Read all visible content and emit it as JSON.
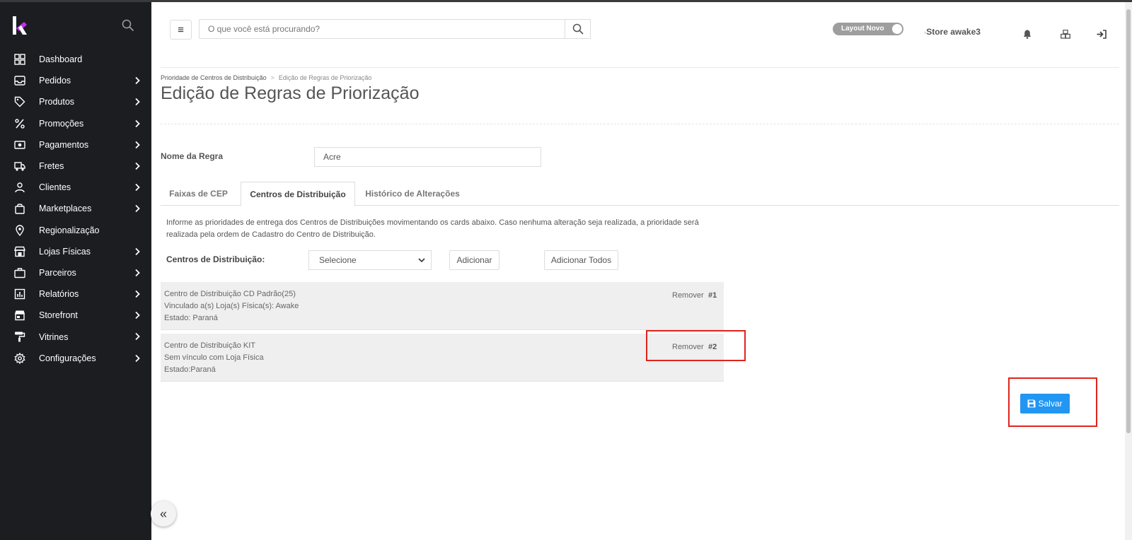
{
  "sidebar": {
    "items": [
      {
        "label": "Dashboard",
        "icon": "dashboard-icon",
        "chevron": false
      },
      {
        "label": "Pedidos",
        "icon": "inbox-icon",
        "chevron": true
      },
      {
        "label": "Produtos",
        "icon": "tag-icon",
        "chevron": true
      },
      {
        "label": "Promoções",
        "icon": "percent-icon",
        "chevron": true
      },
      {
        "label": "Pagamentos",
        "icon": "money-icon",
        "chevron": true
      },
      {
        "label": "Fretes",
        "icon": "truck-icon",
        "chevron": true
      },
      {
        "label": "Clientes",
        "icon": "user-icon",
        "chevron": true
      },
      {
        "label": "Marketplaces",
        "icon": "shopping-bag-icon",
        "chevron": true
      },
      {
        "label": "Regionalização",
        "icon": "location-pin-icon",
        "chevron": false
      },
      {
        "label": "Lojas Físicas",
        "icon": "store-icon",
        "chevron": true
      },
      {
        "label": "Parceiros",
        "icon": "briefcase-icon",
        "chevron": true
      },
      {
        "label": "Relatórios",
        "icon": "report-icon",
        "chevron": true
      },
      {
        "label": "Storefront",
        "icon": "storefront-icon",
        "chevron": true
      },
      {
        "label": "Vitrines",
        "icon": "paint-roller-icon",
        "chevron": true
      },
      {
        "label": "Configurações",
        "icon": "gear-icon",
        "chevron": true
      }
    ]
  },
  "header": {
    "search_placeholder": "O que você está procurando?",
    "toggle_label": "Layout Novo",
    "store_alt": "Store awake3"
  },
  "breadcrumb": {
    "parent": "Prioridade de Centros de Distribuição",
    "separator": ">",
    "current": "Edição de Regras de Priorização"
  },
  "page_title": "Edição de Regras de Priorização",
  "form": {
    "name_label": "Nome da Regra",
    "name_value": "Acre"
  },
  "tabs": [
    {
      "label": "Faixas de CEP",
      "active": false
    },
    {
      "label": "Centros de Distribuição",
      "active": true
    },
    {
      "label": "Histórico de Alterações",
      "active": false
    }
  ],
  "info_text": "Informe as prioridades de entrega dos Centros de Distribuições movimentando os cards abaixo. Caso nenhuma alteração seja realizada, a prioridade será realizada pela ordem de Cadastro do Centro de Distribuição.",
  "cd": {
    "label": "Centros de Distribuição:",
    "select_value": "Selecione",
    "add_button": "Adicionar",
    "add_all_button": "Adicionar Todos"
  },
  "cards": [
    {
      "lines": [
        "Centro de Distribuição CD Padrão(25)",
        "Vinculado a(s) Loja(s) Física(s): Awake",
        "Estado: Paraná"
      ],
      "remove": "Remover",
      "priority": "#1"
    },
    {
      "lines": [
        "Centro de Distribuição KIT",
        "Sem vínculo com Loja Física",
        "Estado:Paraná"
      ],
      "remove": "Remover",
      "priority": "#2"
    }
  ],
  "save_button": "Salvar",
  "colors": {
    "sidebar_bg": "#1c1d21",
    "primary": "#2196f3",
    "highlight": "#e0241c",
    "logo_accent": "#c62ff0"
  }
}
